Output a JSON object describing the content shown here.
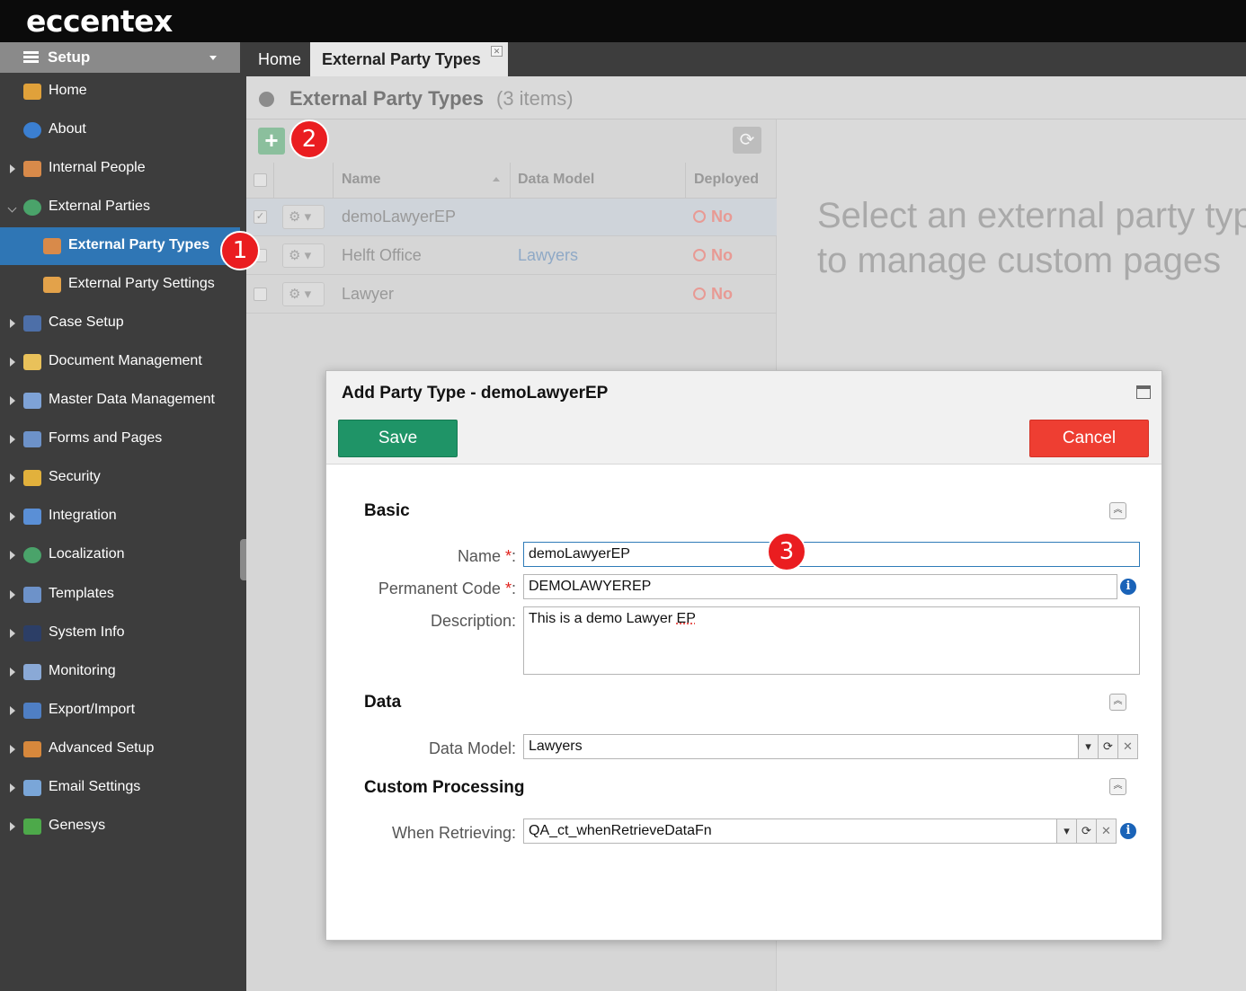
{
  "app": {
    "logo": "eccentex"
  },
  "sidebar": {
    "header": "Setup",
    "items": [
      {
        "label": "Home",
        "icon": "home-icon",
        "expandable": false
      },
      {
        "label": "About",
        "icon": "info-icon",
        "expandable": false
      },
      {
        "label": "Internal People",
        "icon": "users-icon",
        "expandable": true
      },
      {
        "label": "External Parties",
        "icon": "globe-icon",
        "expandable": true,
        "expanded": true
      },
      {
        "label": "External Party Types",
        "icon": "party-types-icon",
        "child": true,
        "active": true
      },
      {
        "label": "External Party Settings",
        "icon": "party-settings-icon",
        "child": true
      },
      {
        "label": "Case Setup",
        "icon": "hierarchy-icon",
        "expandable": true
      },
      {
        "label": "Document Management",
        "icon": "folder-icon",
        "expandable": true
      },
      {
        "label": "Master Data Management",
        "icon": "table-icon",
        "expandable": true
      },
      {
        "label": "Forms and Pages",
        "icon": "form-icon",
        "expandable": true
      },
      {
        "label": "Security",
        "icon": "lock-icon",
        "expandable": true
      },
      {
        "label": "Integration",
        "icon": "plug-icon",
        "expandable": true
      },
      {
        "label": "Localization",
        "icon": "globe-icon",
        "expandable": true
      },
      {
        "label": "Templates",
        "icon": "template-icon",
        "expandable": true
      },
      {
        "label": "System Info",
        "icon": "terminal-icon",
        "expandable": true
      },
      {
        "label": "Monitoring",
        "icon": "monitor-icon",
        "expandable": true
      },
      {
        "label": "Export/Import",
        "icon": "floppy-icon",
        "expandable": true
      },
      {
        "label": "Advanced Setup",
        "icon": "wrench-icon",
        "expandable": true
      },
      {
        "label": "Email Settings",
        "icon": "email-icon",
        "expandable": true
      },
      {
        "label": "Genesys",
        "icon": "puzzle-icon",
        "expandable": true
      }
    ]
  },
  "tabs": [
    {
      "label": "Home"
    },
    {
      "label": "External Party Types",
      "active": true,
      "close": "✕"
    }
  ],
  "main": {
    "title": "External Party Types",
    "count": "(3 items)",
    "add_label": "+",
    "refresh_label": "⟳",
    "columns": {
      "name": "Name",
      "data_model": "Data Model",
      "deployed": "Deployed"
    },
    "rows": [
      {
        "name": "demoLawyerEP",
        "data_model": "",
        "deployed": "No",
        "checked": true
      },
      {
        "name": "Helft Office",
        "data_model": "Lawyers",
        "deployed": "No"
      },
      {
        "name": "Lawyer",
        "data_model": "",
        "deployed": "No"
      }
    ],
    "gear_label": "⚙ ▾",
    "empty_message": "Select an external party type\nto manage custom pages"
  },
  "badges": [
    "1",
    "2",
    "3"
  ],
  "dialog": {
    "title": "Add Party Type - demoLawyerEP",
    "save_label": "Save",
    "cancel_label": "Cancel",
    "sections": {
      "basic": "Basic",
      "data": "Data",
      "custom": "Custom Processing"
    },
    "fields": {
      "name_label": "Name",
      "name_value": "demoLawyerEP",
      "code_label": "Permanent Code",
      "code_value": "DEMOLAWYEREP",
      "desc_label": "Description:",
      "desc_value_pre": "This is a demo Lawyer ",
      "desc_value_mark": "EP",
      "data_model_label": "Data Model:",
      "data_model_value": "Lawyers",
      "when_retrieving_label": "When Retrieving:",
      "when_retrieving_value": "QA_ct_whenRetrieveDataFn",
      "required_mark": "*",
      "colon": ":"
    }
  },
  "colors": {
    "active_sidebar": "#2f76b5",
    "save": "#1f9467",
    "cancel": "#ee3e32",
    "badge": "#ea1d20"
  }
}
